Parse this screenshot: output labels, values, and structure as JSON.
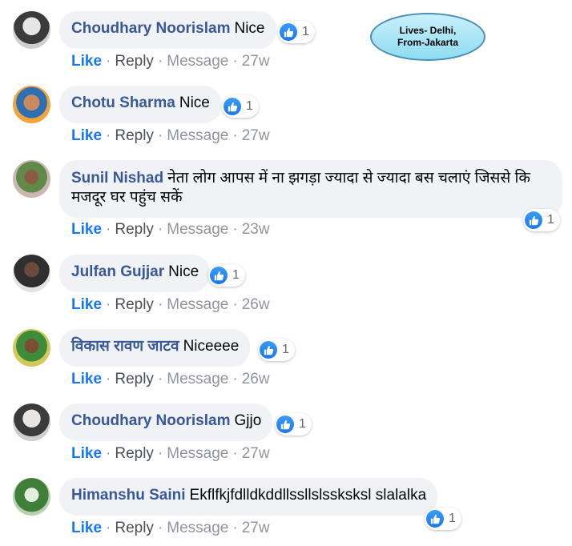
{
  "callout": {
    "line1": "Lives- Delhi,",
    "line2": "From-Jakarta"
  },
  "actions": {
    "like": "Like",
    "reply": "Reply",
    "message": "Message",
    "dot": "·"
  },
  "comments": [
    {
      "author": "Choudhary Noorislam",
      "text": "Nice",
      "reactions": "1",
      "time": "27w"
    },
    {
      "author": "Chotu Sharma",
      "text": "Nice",
      "reactions": "1",
      "time": "27w"
    },
    {
      "author": "Sunil Nishad",
      "text": "नेता लोग आपस में ना झगड़ा ज्यादा से ज्यादा बस चलाएं जिससे कि मजदूर घर पहुंच सकें",
      "reactions": "1",
      "time": "23w"
    },
    {
      "author": "Julfan Gujjar",
      "text": "Nice",
      "reactions": "1",
      "time": "26w"
    },
    {
      "author": "विकास रावण जाटव",
      "text": "Niceeee",
      "reactions": "1",
      "time": "26w"
    },
    {
      "author": "Choudhary Noorislam",
      "text": "Gjjo",
      "reactions": "1",
      "time": "27w"
    },
    {
      "author": "Himanshu Saini",
      "text": "Ekflfkjfdlldkddllssllslssksksl slalalka",
      "reactions": "1",
      "time": "27w"
    }
  ],
  "colors": {
    "author": "#385898",
    "like": "#1877f2",
    "bubble": "#f0f2f5",
    "meta": "#90949c"
  }
}
